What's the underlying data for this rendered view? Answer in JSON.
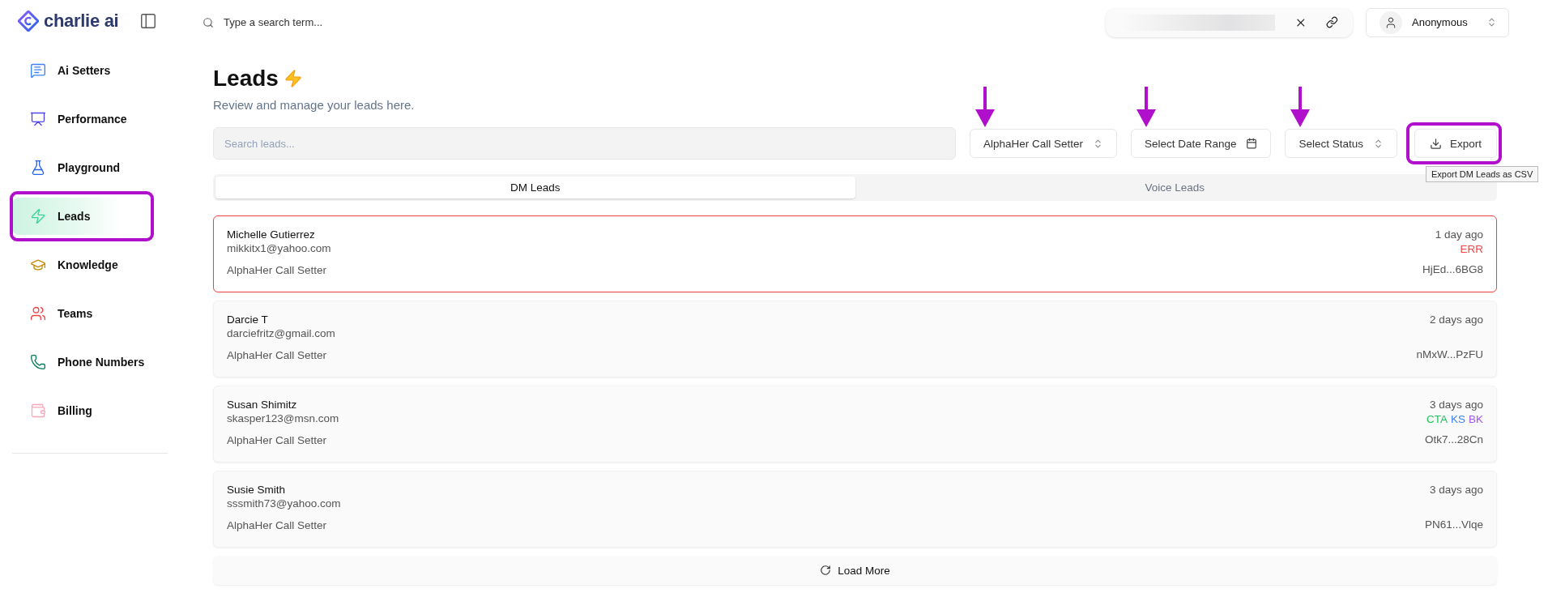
{
  "brand": {
    "name": "charlie ai"
  },
  "topbar": {
    "search_placeholder": "Type a search term...",
    "user": "Anonymous"
  },
  "sidebar": {
    "items": [
      {
        "label": "Ai Setters",
        "kind": "setters",
        "selected": false,
        "highlighted": false
      },
      {
        "label": "Performance",
        "kind": "performance",
        "selected": false,
        "highlighted": false
      },
      {
        "label": "Playground",
        "kind": "playground",
        "selected": false,
        "highlighted": false
      },
      {
        "label": "Leads",
        "kind": "leads",
        "selected": true,
        "highlighted": true
      },
      {
        "label": "Knowledge",
        "kind": "knowledge",
        "selected": false,
        "highlighted": false
      },
      {
        "label": "Teams",
        "kind": "teams",
        "selected": false,
        "highlighted": false
      },
      {
        "label": "Phone Numbers",
        "kind": "phone",
        "selected": false,
        "highlighted": false
      },
      {
        "label": "Billing",
        "kind": "billing",
        "selected": false,
        "highlighted": false
      }
    ]
  },
  "page": {
    "title": "Leads",
    "subtitle": "Review and manage your leads here."
  },
  "search": {
    "placeholder": "Search leads..."
  },
  "filters": [
    {
      "label": "AlphaHer Call Setter",
      "kind": "select",
      "marked": true
    },
    {
      "label": "Select Date Range",
      "kind": "date",
      "marked": true
    },
    {
      "label": "Select Status",
      "kind": "select",
      "marked": true
    }
  ],
  "export": {
    "label": "Export",
    "highlighted": true,
    "tooltip": "Export DM Leads as CSV"
  },
  "tabs": [
    {
      "label": "DM Leads",
      "selected": true
    },
    {
      "label": "Voice Leads",
      "selected": false
    }
  ],
  "leads": [
    {
      "name": "Michelle Gutierrez",
      "email": "mikkitx1@yahoo.com",
      "setter": "AlphaHer Call Setter",
      "time": "1 day ago",
      "error": true,
      "tags": [
        {
          "text": "ERR",
          "color": "#ef4444"
        }
      ],
      "id": "HjEd...6BG8"
    },
    {
      "name": "Darcie T",
      "email": "darciefritz@gmail.com",
      "setter": "AlphaHer Call Setter",
      "time": "2 days ago",
      "error": false,
      "id": "nMxW...PzFU"
    },
    {
      "name": "Susan Shimitz",
      "email": "skasper123@msn.com",
      "setter": "AlphaHer Call Setter",
      "time": "3 days ago",
      "error": false,
      "tags": [
        {
          "text": "CTA",
          "color": "#22c55e"
        },
        {
          "text": "KS",
          "color": "#3b82f6"
        },
        {
          "text": "BK",
          "color": "#a855f7"
        }
      ],
      "id": "Otk7...28Cn"
    },
    {
      "name": "Susie Smith",
      "email": "sssmith73@yahoo.com",
      "setter": "AlphaHer Call Setter",
      "time": "3 days ago",
      "error": false,
      "id": "PN61...Vlqe"
    }
  ],
  "load_more": {
    "label": "Load More"
  }
}
